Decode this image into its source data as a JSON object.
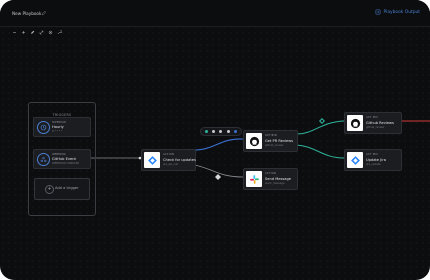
{
  "header": {
    "title": "New Playbook",
    "output_label": "Playbook Output"
  },
  "toolbar": {
    "icons": [
      "minus-icon",
      "plus-icon",
      "pen-icon",
      "resize-icon",
      "target-icon",
      "wrench-icon"
    ]
  },
  "triggers": {
    "title": "TRIGGERS",
    "items": [
      {
        "small": "SCHEDULE",
        "main": "Hourly",
        "sub": "0 * * * *"
      },
      {
        "small": "WEBHOOK",
        "main": "GitHub Event",
        "sub": "WEBHOOK HANDLER"
      }
    ],
    "add_label": "Add a trigger"
  },
  "nodes": {
    "check_updates": {
      "small": "ACTION",
      "main": "Check for updates",
      "sub": "jira_api_call"
    },
    "get_pr": {
      "small": "GETIBIN",
      "main": "Get PR Reviews",
      "sub": "github_review"
    },
    "send_message": {
      "small": "ACTION",
      "main": "Send Message",
      "sub": "slack_message"
    },
    "github_reviews": {
      "small": "ACT MIX",
      "main": "Github Reviews",
      "sub": "github_review"
    },
    "update_jira": {
      "small": "ACT MIX",
      "main": "Update Jira",
      "sub": "jira_update"
    }
  },
  "colors": {
    "accent": "#4a7fd1",
    "edge_blue": "#3b6fd0",
    "edge_teal": "#2fb39a",
    "edge_red": "#d03a3a",
    "edge_gray": "#8a8d92"
  }
}
